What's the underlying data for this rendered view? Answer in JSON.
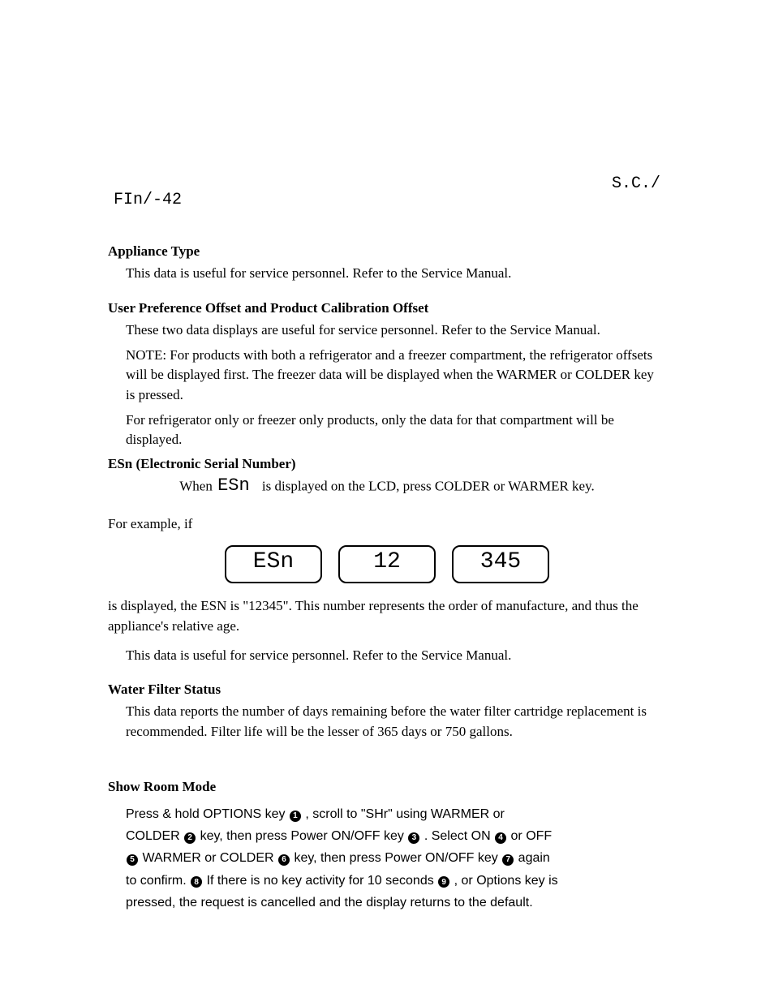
{
  "header": {
    "mfr_model": "FIn/-42",
    "sc_label": "S.C./"
  },
  "sections": {
    "appliance_type": {
      "title": "Appliance Type",
      "body": "This data is useful for service personnel. Refer to the Service Manual."
    },
    "calibration_offset": {
      "title": "User Preference Offset and Product Calibration Offset",
      "paras": [
        "These two data displays are useful for service personnel.  Refer to the Service Manual.",
        "NOTE:  For products with both a refrigerator and a freezer compartment, the refrigerator offsets will be displayed first.  The freezer data will be displayed when the WARMER or COLDER key is pressed.",
        "For refrigerator only or freezer only products, only the data for that compartment will be displayed."
      ]
    },
    "esn": {
      "title": "ESn (Electronic Serial Number)",
      "intro_prefix": "When ",
      "intro_code": "ESn",
      "intro_suffix": " is displayed on the LCD, press COLDER or WARMER key.",
      "example_label": "For example, if",
      "display_values": [
        "ESn",
        "12",
        "345"
      ],
      "after_boxes": "is displayed, the ESN is \"12345\".  This number represents the order of manufacture, and thus the appliance's relative age.",
      "extra_para": "This data is useful for service personnel.  Refer to the Service Manual."
    },
    "filter": {
      "title": "Water Filter Status",
      "body": "This data reports the number of days remaining before the water filter cartridge replacement is recommended.  Filter life will be the lesser of 365 days or 750 gallons."
    },
    "showroom": {
      "title": "Show Room Mode",
      "line1_prefix": "Press & hold OPTIONS key ",
      "line1_suffix": ", scroll to \"SHr\" using WARMER or",
      "line2_prefix": "COLDER ",
      "line2_mid1": "  key, then press Power ON/OFF key ",
      "line2_mid2": ".  Select ON  ",
      "line2_end": " or OFF",
      "line3_prefix": "",
      "line3_mid1": " WARMER or COLDER ",
      "line3_mid2": "  key, then press Power ON/OFF key ",
      "line3_end": " again",
      "line4_prefix": "to confirm.  ",
      "line4_mid": "  If there is no key activity for 10 seconds  ",
      "line4_end": ", or Options key is",
      "line5": "pressed, the request is cancelled and the display returns to the default.",
      "circled": {
        "1": "1",
        "2": "2",
        "3": "3",
        "4": "4",
        "5": "5",
        "6": "6",
        "7": "7",
        "8": "8",
        "9": "9"
      }
    }
  },
  "colors": {
    "text": "#000000",
    "bg": "#ffffff"
  }
}
